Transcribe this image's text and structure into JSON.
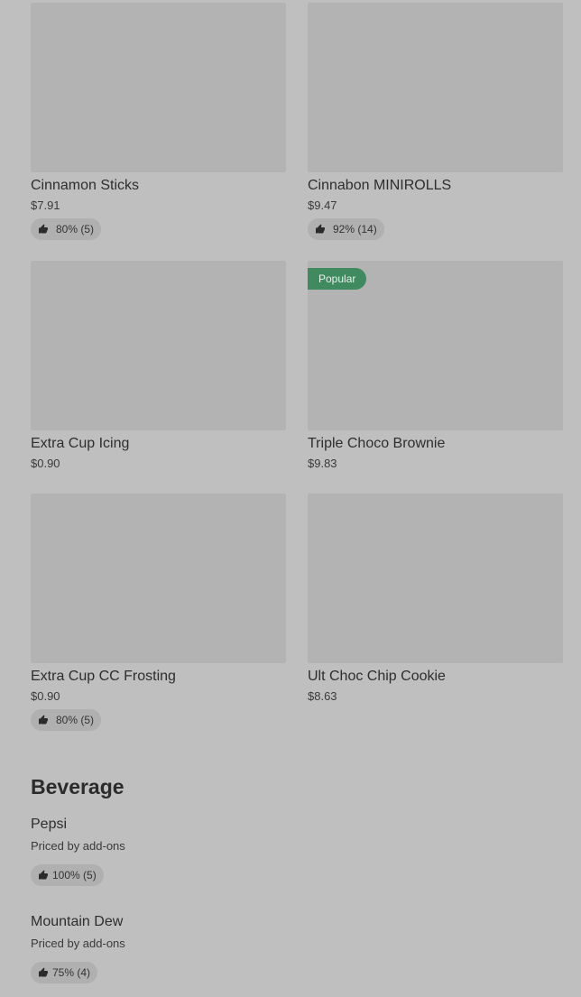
{
  "items": [
    {
      "name": "Cinnamon Sticks",
      "price": "$7.91",
      "rating": "80% (5)"
    },
    {
      "name": "Cinnabon MINIROLLS",
      "price": "$9.47",
      "rating": "92% (14)"
    },
    {
      "name": "Extra Cup Icing",
      "price": "$0.90"
    },
    {
      "name": "Triple Choco Brownie",
      "price": "$9.83",
      "badge": "Popular"
    },
    {
      "name": "Extra Cup CC Frosting",
      "price": "$0.90",
      "rating": "80% (5)"
    },
    {
      "name": "Ult Choc Chip Cookie",
      "price": "$8.63"
    }
  ],
  "section": {
    "title": "Beverage"
  },
  "beverages": [
    {
      "name": "Pepsi",
      "price_note": "Priced by add-ons",
      "rating": "100% (5)"
    },
    {
      "name": "Mountain Dew",
      "price_note": "Priced by add-ons",
      "rating": "75% (4)"
    }
  ],
  "colors": {
    "popular_badge": "#3f8a5f",
    "background": "#bfbfbf",
    "thumb": "#b3b3b3"
  },
  "icons": {
    "rating": "thumbs-up-icon"
  }
}
